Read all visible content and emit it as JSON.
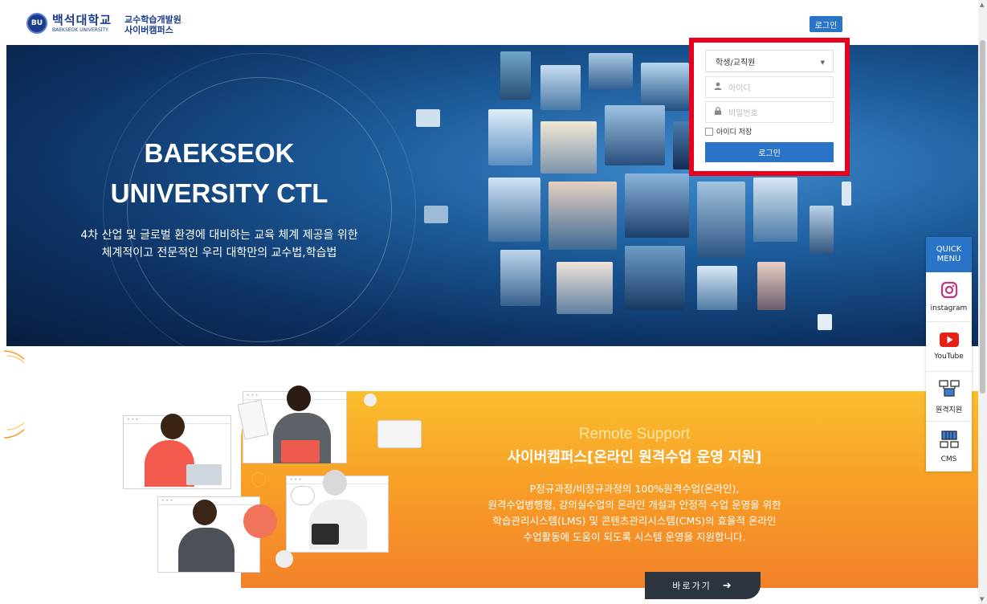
{
  "header": {
    "logo_badge": "BU",
    "logo_ko": "백석대학교",
    "logo_en": "BAEKSEOK UNIVERSITY",
    "sub_line1": "교수학습개발원",
    "sub_line2": "사이버캠퍼스",
    "login_label": "로그인"
  },
  "hero": {
    "title_line1": "BAEKSEOK",
    "title_line2": "UNIVERSITY CTL",
    "desc_line1": "4차 산업 및 글로벌 환경에 대비하는 교육 체계 제공을 위한",
    "desc_line2": "체계적이고 전문적인 우리 대학만의 교수법,학습법"
  },
  "login": {
    "user_type": "학생/교직원",
    "id_placeholder": "아이디",
    "pw_placeholder": "비밀번호",
    "remember_label": "아이디 저장",
    "submit_label": "로그인"
  },
  "quick_menu": {
    "title_line1": "QUICK",
    "title_line2": "MENU",
    "items": [
      {
        "label": "instagram",
        "icon": "instagram-icon"
      },
      {
        "label": "YouTube",
        "icon": "youtube-icon"
      },
      {
        "label": "원격지원",
        "icon": "remote-support-icon"
      },
      {
        "label": "CMS",
        "icon": "cms-icon"
      }
    ]
  },
  "remote": {
    "subtitle": "Remote Support",
    "title": "사이버캠퍼스[온라인 원격수업 운영 지원]",
    "desc_line1": "P정규과정/비정규과정의 100%원격수업(온라인),",
    "desc_line2": "원격수업병행형, 강의실수업의 온라인 개설과 안정적 수업 운영을 위한",
    "desc_line3": "학습관리시스템(LMS) 및 콘텐츠관리시스템(CMS)의 효율적 온라인",
    "desc_line4": "수업활동에 도움이 되도록 시스템 운영을 지원합니다.",
    "button_label": "바로가기",
    "button_arrow": "➜"
  },
  "colors": {
    "brand_blue": "#2a74c7",
    "highlight_red": "#e8001c",
    "orange": "#f79a26"
  }
}
